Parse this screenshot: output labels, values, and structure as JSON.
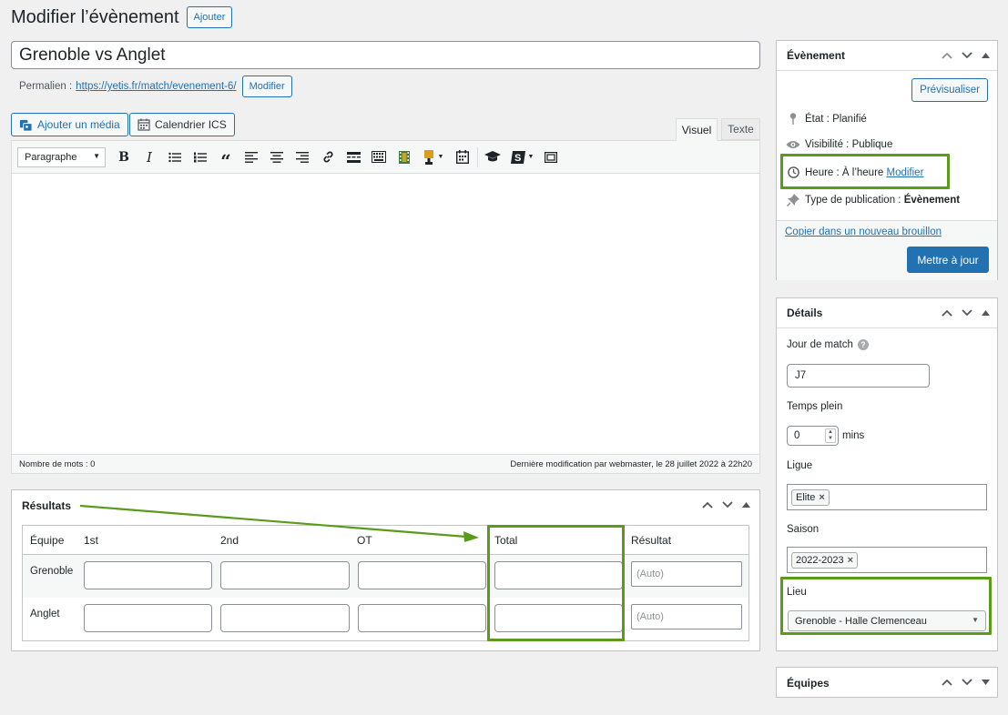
{
  "header": {
    "title": "Modifier l’évènement",
    "add_button": "Ajouter"
  },
  "post": {
    "title_value": "Grenoble vs Anglet",
    "permalink_label": "Permalien :",
    "permalink_url": "https://yetis.fr/match/evenement-6/",
    "permalink_edit": "Modifier"
  },
  "media": {
    "add_media": "Ajouter un média",
    "ics": "Calendrier ICS"
  },
  "editor": {
    "tab_visual": "Visuel",
    "tab_text": "Texte",
    "format_select": "Paragraphe",
    "word_count": "Nombre de mots : 0",
    "last_modified": "Dernière modification par webmaster, le 28 juillet 2022 à 22h20"
  },
  "results": {
    "title": "Résultats",
    "columns": [
      "Équipe",
      "1st",
      "2nd",
      "OT",
      "Total",
      "Résultat"
    ],
    "rows": [
      {
        "team": "Grenoble",
        "result_placeholder": "(Auto)"
      },
      {
        "team": "Anglet",
        "result_placeholder": "(Auto)"
      }
    ]
  },
  "publish": {
    "title": "Évènement",
    "preview": "Prévisualiser",
    "status_label": "État :",
    "status_value": "Planifié",
    "visibility_label": "Visibilité :",
    "visibility_value": "Publique",
    "time_label": "Heure : À l’heure",
    "time_edit": "Modifier",
    "type_label": "Type de publication :",
    "type_value": "Évènement",
    "copy_draft": "Copier dans un nouveau brouillon",
    "update": "Mettre à jour"
  },
  "details": {
    "title": "Détails",
    "matchday_label": "Jour de match",
    "matchday_value": "J7",
    "fulltime_label": "Temps plein",
    "fulltime_value": "0",
    "fulltime_unit": "mins",
    "league_label": "Ligue",
    "league_tag": "Elite",
    "season_label": "Saison",
    "season_tag": "2022-2023",
    "venue_label": "Lieu",
    "venue_value": "Grenoble - Halle Clemenceau"
  },
  "teams_panel": {
    "title": "Équipes"
  },
  "colors": {
    "accent": "#2271b1",
    "highlight": "#5c9a1b"
  }
}
